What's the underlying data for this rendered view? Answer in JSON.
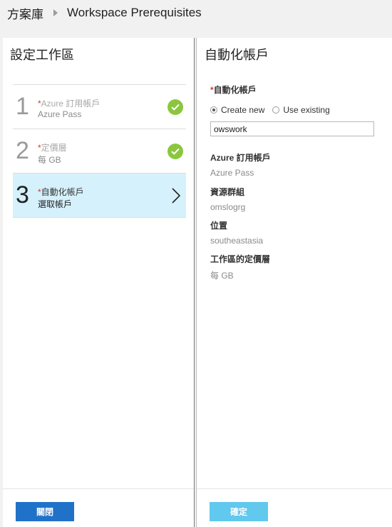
{
  "breadcrumb": {
    "root": "方案庫",
    "current": "Workspace Prerequisites"
  },
  "left_blade": {
    "title": "設定工作區",
    "steps": [
      {
        "number": "1",
        "required_mark": "*",
        "title": "Azure 訂用帳戶",
        "subtitle": "Azure Pass",
        "status": "check-icon"
      },
      {
        "number": "2",
        "required_mark": "*",
        "title": "定價層",
        "subtitle": "每 GB",
        "status": "check-icon"
      },
      {
        "number": "3",
        "required_mark": "*",
        "title": "自動化帳戶",
        "subtitle": "選取帳戶",
        "status": "chevron-right-icon"
      }
    ],
    "close_label": "關閉"
  },
  "right_blade": {
    "title": "自動化帳戶",
    "account_label": "自動化帳戶",
    "required_mark": "*",
    "radio_create": "Create new",
    "radio_existing": "Use existing",
    "selected_option": "Create new",
    "account_value": "owswork",
    "subscription_label": "Azure 訂用帳戶",
    "subscription_value": "Azure Pass",
    "resource_group_label": "資源群組",
    "resource_group_value": "omslogrg",
    "location_label": "位置",
    "location_value": "southeastasia",
    "pricing_label": "工作區的定價層",
    "pricing_value": "每 GB",
    "ok_label": "確定"
  },
  "colors": {
    "accent": "#2072c9",
    "ok_button": "#61c8ee",
    "success": "#8cc63f",
    "active_step": "#d5f1fb",
    "required": "#d9372c"
  }
}
